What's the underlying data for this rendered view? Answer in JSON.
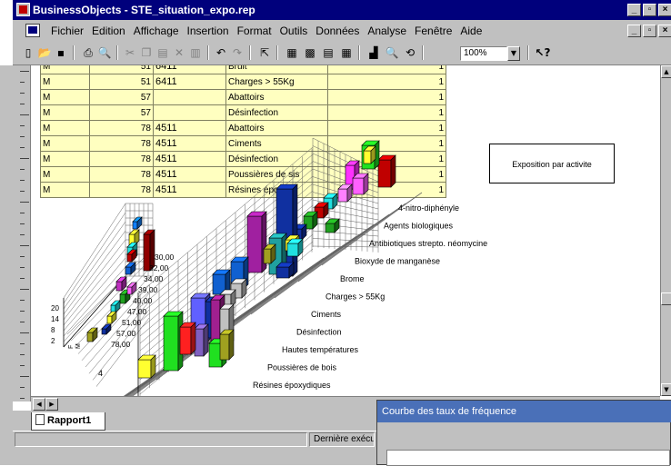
{
  "window": {
    "title": "BusinessObjects - STE_situation_expo.rep"
  },
  "menu": {
    "items": [
      "Fichier",
      "Edition",
      "Affichage",
      "Insertion",
      "Format",
      "Outils",
      "Données",
      "Analyse",
      "Fenêtre",
      "Aide"
    ]
  },
  "toolbar": {
    "zoom": "100%"
  },
  "table": {
    "rows": [
      [
        "M",
        "51",
        "6411",
        "Bruit",
        "1"
      ],
      [
        "M",
        "51",
        "6411",
        "Charges > 55Kg",
        "1"
      ],
      [
        "M",
        "57",
        "",
        "Abattoirs",
        "1"
      ],
      [
        "M",
        "57",
        "",
        "Désinfection",
        "1"
      ],
      [
        "M",
        "78",
        "4511",
        "Abattoirs",
        "1"
      ],
      [
        "M",
        "78",
        "4511",
        "Ciments",
        "1"
      ],
      [
        "M",
        "78",
        "4511",
        "Désinfection",
        "1"
      ],
      [
        "M",
        "78",
        "4511",
        "Poussières de sis",
        "1"
      ],
      [
        "M",
        "78",
        "4511",
        "Résines époxy",
        "1"
      ]
    ]
  },
  "legend_box": "Exposition par activite",
  "chart_left": {
    "ylabels": [
      "20",
      "14",
      "8",
      "2"
    ],
    "xlabels": [
      "30,00",
      "32,00",
      "34,00",
      "39,00",
      "40,00",
      "47,00",
      "51,00",
      "57,00",
      "78,00"
    ],
    "axis_side": [
      "F",
      "M"
    ]
  },
  "chart_main": {
    "categories": [
      "4-nitro-diphényle",
      "Agents biologiques",
      "Antibiotiques strepto. néomycine",
      "Bioxyde de manganèse",
      "Brome",
      "Charges > 55Kg",
      "Ciments",
      "Désinfection",
      "Hautes températures",
      "Poussières de bois",
      "Résines époxydiques"
    ],
    "axis_mark": "4"
  },
  "tabs": {
    "active": "Rapport1"
  },
  "status": {
    "text": "Dernière exécu"
  },
  "popup": {
    "title": "Courbe des taux de fréquence"
  },
  "icons": [
    "open-icon",
    "save-icon",
    "print-icon",
    "preview-icon",
    "cut-icon",
    "copy-icon",
    "paste-icon",
    "delete-icon",
    "undo-icon",
    "redo-icon",
    "help-icon"
  ]
}
